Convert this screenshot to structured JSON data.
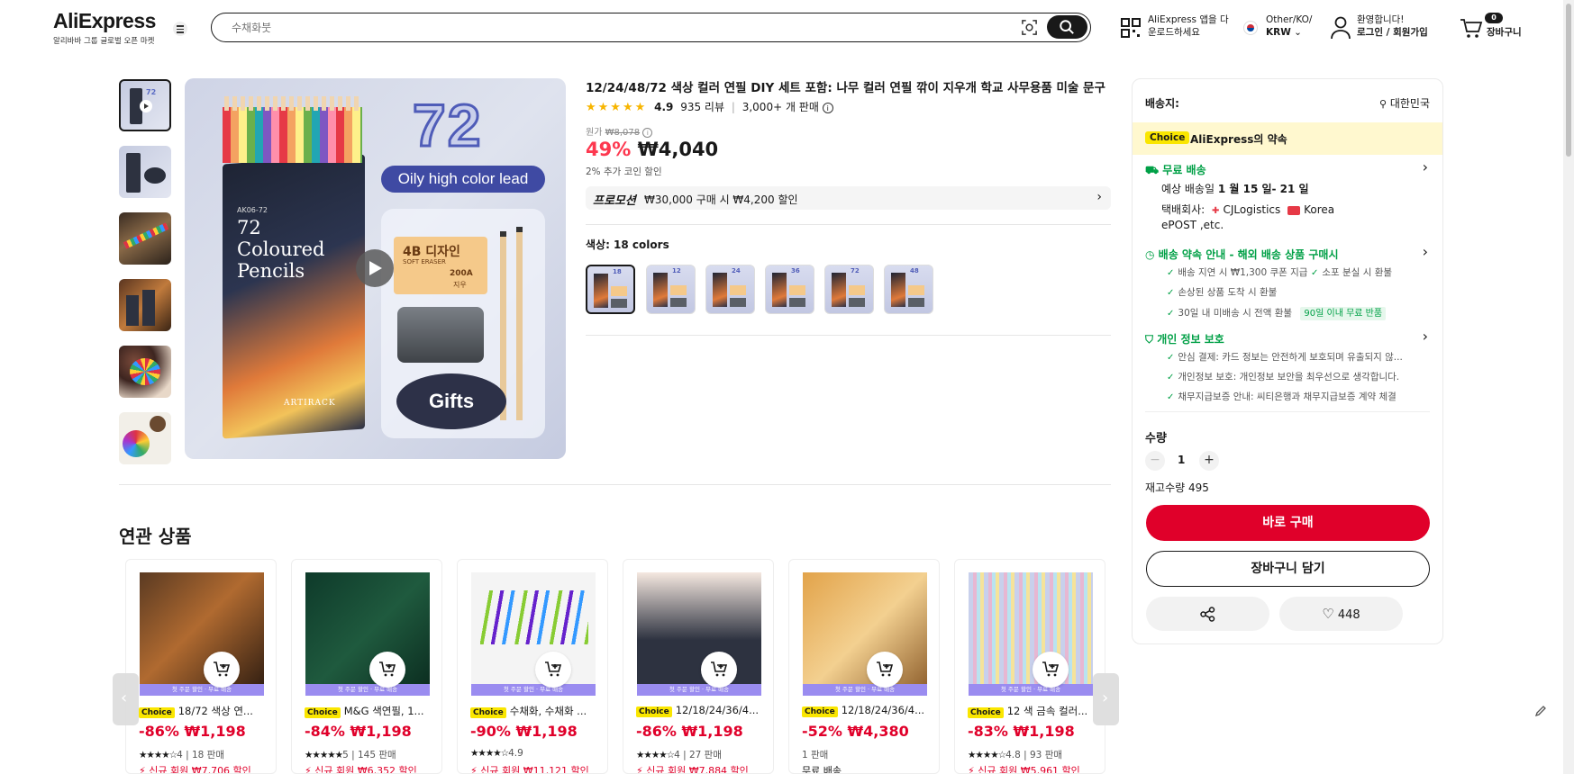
{
  "header": {
    "logo": "AliExpress",
    "logo_sub": "알리바바 그룹 글로벌 오픈 마켓",
    "search_placeholder": "수채화붓",
    "app_line1": "AliExpress 앱을 다",
    "app_line2": "운로드하세요",
    "locale_line1": "Other/KO/",
    "locale_line2": "KRW",
    "account_line1": "환영합니다!",
    "account_line2": "로그인 / 회원가입",
    "cart_count": "0",
    "cart_label": "장바구니"
  },
  "product": {
    "title": "12/24/48/72 색상 컬러 연필 DIY 세트 포함: 나무 컬러 연필 깎이 지우개 학교 사무용품 미술 문구",
    "rating": "4.9",
    "reviews": "935 리뷰",
    "sold": "3,000+ 개 판매",
    "original_label": "원가",
    "original_price": "₩8,078",
    "discount": "49%",
    "price": "₩4,040",
    "coin": "2% 추가 코인 할인",
    "promo_label": "프로모션",
    "promo_text": "₩30,000 구매 시 ₩4,200 할인",
    "color_label": "색상: 18 colors",
    "color_numbers": [
      "18",
      "12",
      "24",
      "36",
      "72",
      "48"
    ],
    "image": {
      "big_number": "72",
      "oily": "Oily high color lead",
      "gifts": "Gifts",
      "box_num": "72",
      "box_line1": "Coloured",
      "box_line2": "Pencils",
      "brand": "ARTIRACK",
      "eraser_title": "4B 디자인",
      "eraser_sub": "SOFT ERASER",
      "eraser_size": "200A",
      "eraser_kr": "지우"
    }
  },
  "panel": {
    "ship_to_label": "배송지:",
    "ship_to_value": "대한민국",
    "choice_tag": "Choice",
    "choice_promise": "AliExpress의 약속",
    "free_ship": "무료 배송",
    "est_prefix": "예상 배송일",
    "est_dates": "1 월 15 일- 21 일",
    "carrier_label": "택배회사:",
    "carrier1": "CJLogistics",
    "carrier2": "Korea",
    "carrier3": "ePOST ,etc.",
    "guarantee_title": "배송 약속 안내 - 해외 배송 상품 구매시",
    "g1": "배송 지연 시 ₩1,300 쿠폰 지급",
    "g2": "소포 분실 시 환불",
    "g3": "손상된 상품 도착 시 환불",
    "g4": "30일 내 미배송 시 전액 환불",
    "g4_badge": "90일 이내 무료 반품",
    "privacy_title": "개인 정보 보호",
    "p1": "안심 결제: 카드 정보는 안전하게 보호되며 유출되지 않...",
    "p2": "개인정보 보호: 개인정보 보안을 최우선으로 생각합니다.",
    "p3": "채무지급보증 안내: 씨티은행과 채무지급보증 계약 체결",
    "qty_label": "수량",
    "qty_value": "1",
    "stock": "재고수량 495",
    "buy_now": "바로 구매",
    "add_cart": "장바구니 담기",
    "wish_count": "448"
  },
  "related": {
    "title": "연관 상품",
    "band_text": "첫 주문 할인 · 무료 배송",
    "items": [
      {
        "choice": "Choice",
        "name": "18/72 색상 연...",
        "discount": "-86%",
        "price": "₩1,198",
        "stars": "★★★★☆",
        "rating": "4",
        "sold": "18 판매",
        "coupon": "신규 회원 ₩7,706 할인"
      },
      {
        "choice": "Choice",
        "name": "M&G 색연필, 1...",
        "discount": "-84%",
        "price": "₩1,198",
        "stars": "★★★★★",
        "rating": "5",
        "sold": "145 판매",
        "coupon": "신규 회원 ₩6,352 할인"
      },
      {
        "choice": "Choice",
        "name": "수채화, 수채화 ...",
        "discount": "-90%",
        "price": "₩1,198",
        "stars": "★★★★☆",
        "rating": "4.9",
        "sold": "",
        "coupon": "신규 회원 ₩11,121 할인"
      },
      {
        "choice": "Choice",
        "name": "12/18/24/36/4...",
        "discount": "-86%",
        "price": "₩1,198",
        "stars": "★★★★☆",
        "rating": "4",
        "sold": "27 판매",
        "coupon": "신규 회원 ₩7,884 할인"
      },
      {
        "choice": "Choice",
        "name": "12/18/24/36/4...",
        "discount": "-52%",
        "price": "₩4,380",
        "stars": "",
        "rating": "",
        "sold": "1 판매",
        "coupon": "무료 배송"
      },
      {
        "choice": "Choice",
        "name": "12 색 금속 컬러...",
        "discount": "-83%",
        "price": "₩1,198",
        "stars": "★★★★☆",
        "rating": "4.8",
        "sold": "93 판매",
        "coupon": "신규 회원 ₩5,961 할인"
      }
    ]
  },
  "colors": {
    "accent_red": "#fd384f",
    "buy_red": "#e0002a",
    "choice_yellow": "#fae600",
    "green": "#00a046"
  }
}
